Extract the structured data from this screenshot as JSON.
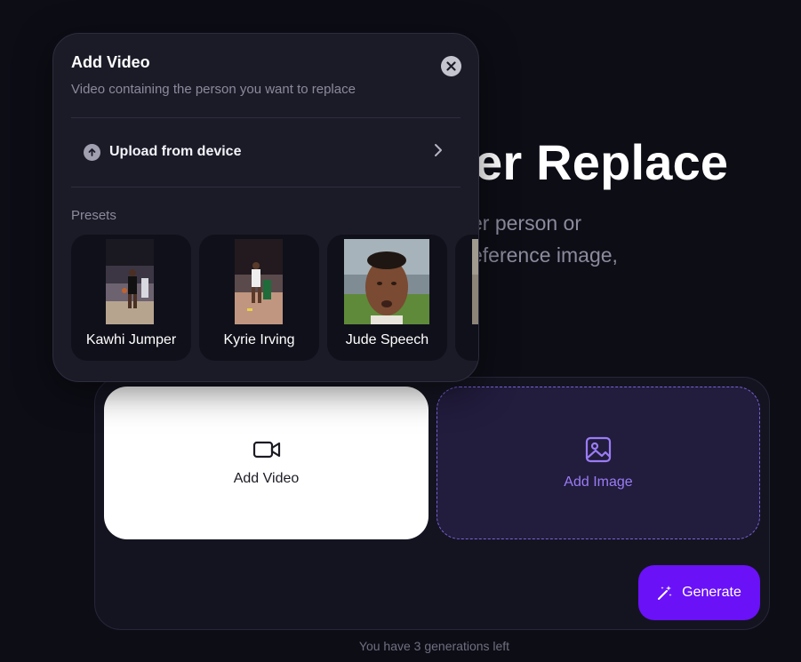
{
  "hero": {
    "title_visible": "er Replace",
    "subtitle_line1": "er person or",
    "subtitle_line2": "eference image,"
  },
  "generator": {
    "video_slot_label": "Add Video",
    "image_slot_label": "Add Image",
    "generate_label": "Generate",
    "generations_left": "You have 3 generations left"
  },
  "popup": {
    "title": "Add Video",
    "description": "Video containing the person you want to replace",
    "upload_label": "Upload from device",
    "presets_label": "Presets",
    "presets": [
      {
        "name": "Kawhi Jumper"
      },
      {
        "name": "Kyrie Irving"
      },
      {
        "name": "Jude Speech"
      }
    ]
  },
  "colors": {
    "background": "#0d0d16",
    "accent": "#6a11f7",
    "image_slot": "#221c3d",
    "image_slot_text": "#9a7cf5"
  },
  "icons": [
    "video-camera-icon",
    "image-icon",
    "magic-wand-icon",
    "close-icon",
    "upload-icon",
    "chevron-right-icon"
  ]
}
